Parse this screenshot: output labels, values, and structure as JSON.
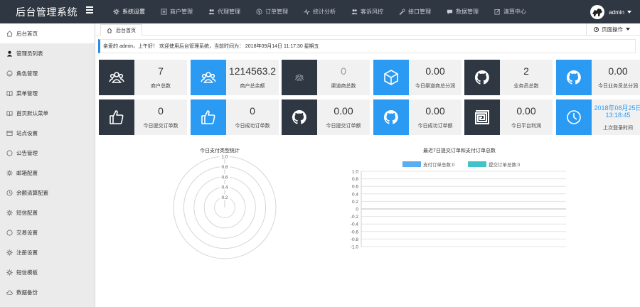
{
  "app": {
    "title": "后台管理系统",
    "user": "admin"
  },
  "nav": [
    {
      "label": "系统设置",
      "icon": "gear-icon"
    },
    {
      "label": "商户管理",
      "icon": "list-icon"
    },
    {
      "label": "代理管理",
      "icon": "users-icon"
    },
    {
      "label": "订单管理",
      "icon": "order-icon"
    },
    {
      "label": "统计分析",
      "icon": "pulse-icon"
    },
    {
      "label": "客诉风控",
      "icon": "users-icon"
    },
    {
      "label": "接口管理",
      "icon": "wrench-icon"
    },
    {
      "label": "数据管理",
      "icon": "chat-icon"
    },
    {
      "label": "清算中心",
      "icon": "edit-icon"
    }
  ],
  "sidebar": {
    "items": [
      {
        "label": "后台首页",
        "icon": "home-icon"
      },
      {
        "label": "管理员列表",
        "icon": "user-icon"
      },
      {
        "label": "角色管理",
        "icon": "smile-icon"
      },
      {
        "label": "菜单管理",
        "icon": "book-icon"
      },
      {
        "label": "首页默认菜单",
        "icon": "book-icon"
      },
      {
        "label": "站点设置",
        "icon": "window-icon"
      },
      {
        "label": "公告管理",
        "icon": "circle-icon"
      },
      {
        "label": "邮箱配置",
        "icon": "gear-icon"
      },
      {
        "label": "余额清算配置",
        "icon": "clock-icon"
      },
      {
        "label": "短信配置",
        "icon": "gear-icon"
      },
      {
        "label": "交易设置",
        "icon": "circle-icon"
      },
      {
        "label": "注册设置",
        "icon": "gear-icon"
      },
      {
        "label": "短信模板",
        "icon": "gear-icon"
      },
      {
        "label": "数据备份",
        "icon": "cloud-icon"
      }
    ]
  },
  "tabs": {
    "home": "后台首页",
    "page_actions": "页面操作"
  },
  "welcome": "亲爱的 admin，上午好！ 欢迎使用后台管理系统，当前时间为：  2018年09月14日  11:17:30    星期五",
  "cards": [
    {
      "value": "7",
      "label": "商户总数",
      "icon": "team-icon",
      "theme": "dark"
    },
    {
      "value": "1214563.2",
      "label": "商户总余额",
      "icon": "team-icon",
      "theme": "blue"
    },
    {
      "value": "0",
      "label": "渠道商总数",
      "icon": "team-icon",
      "theme": "dark",
      "muted": true
    },
    {
      "value": "0.00",
      "label": "今日渠道商总分润",
      "icon": "cube-icon",
      "theme": "blue"
    },
    {
      "value": "2",
      "label": "业务员总数",
      "icon": "github-icon",
      "theme": "dark"
    },
    {
      "value": "0.00",
      "label": "今日业务员总分润",
      "icon": "github-icon",
      "theme": "blue"
    },
    {
      "value": "0",
      "label": "今日提交订单数",
      "icon": "thumbs-up-icon",
      "theme": "dark"
    },
    {
      "value": "0",
      "label": "今日成功订单数",
      "icon": "thumbs-up-icon",
      "theme": "blue"
    },
    {
      "value": "0.00",
      "label": "今日提交订单额",
      "icon": "github-icon",
      "theme": "dark"
    },
    {
      "value": "0.00",
      "label": "今日成功订单额",
      "icon": "github-icon",
      "theme": "blue"
    },
    {
      "value": "0.00",
      "label": "今日平台利润",
      "icon": "maze-icon",
      "theme": "dark"
    },
    {
      "value": "2018年08月25日\n13:18:45",
      "label": "上次登录时间",
      "icon": "clock-icon",
      "theme": "blue",
      "date": true
    }
  ],
  "chart_data": [
    {
      "type": "radar",
      "title": "今日支付类型统计",
      "radial_ticks": [
        "1.0",
        "0.8",
        "0.6",
        "0.4",
        "0.2"
      ],
      "rlim": [
        0,
        1.0
      ],
      "series": []
    },
    {
      "type": "bar",
      "title": "最近7日提交订单和支付订单总数",
      "legend": "top",
      "series": [
        {
          "name": "支付订单总数:0",
          "color": "#5aaef0",
          "values": []
        },
        {
          "name": "提交订单总数:0",
          "color": "#41c4c7",
          "values": []
        }
      ],
      "yticks": [
        "1.0",
        "0.8",
        "0.6",
        "0.4",
        "0.2",
        "0",
        "-0.2",
        "-0.4",
        "-0.6",
        "-0.8",
        "-1.0"
      ],
      "ylim": [
        -1.0,
        1.0
      ],
      "grid": true
    }
  ]
}
